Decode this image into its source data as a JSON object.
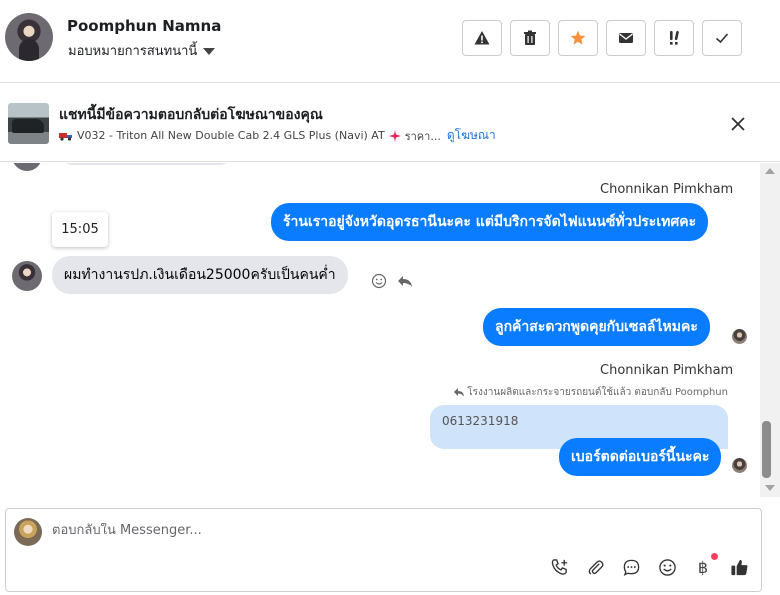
{
  "header": {
    "contact_name": "Poomphun Namna",
    "assign_label": "มอบหมายการสนทนานี้",
    "actions": [
      {
        "name": "spam-button",
        "icon": "warning-icon"
      },
      {
        "name": "delete-button",
        "icon": "trash-icon"
      },
      {
        "name": "star-button",
        "icon": "star-icon",
        "color": "#f7923a"
      },
      {
        "name": "mark-unread-button",
        "icon": "envelope-icon"
      },
      {
        "name": "follow-up-button",
        "icon": "priority-icon"
      },
      {
        "name": "done-button",
        "icon": "check-icon"
      }
    ]
  },
  "ad": {
    "title": "แชทนี้มีข้อความตอบกลับต่อโฆษณาของคุณ",
    "subtitle": "V032 - Triton All New Double Cab 2.4 GLS Plus (Navi) AT",
    "subtitle_tail": "ราคา...",
    "link": "ดูโฆษณา"
  },
  "messages": {
    "sender_1": "Chonnikan Pimkham",
    "out_1": "ร้านเราอยู่จังหวัดอุดรธานีนะคะ แต่มีบริการจัดไฟแนนซ์ทั่วประเทศคะ",
    "timestamp": "15:05",
    "in_1": "ผมทำงานรปภ.เงินเดือน25000ครับเป็นคนค่ำ",
    "out_2": "ลูกค้าสะดวกพูดคุยกับเซลล์ไหมคะ",
    "sender_2": "Chonnikan Pimkham",
    "reply_meta": "โรงงานผลิตและกระจายรถยนต์ใช้แล้ว ตอบกลับ Poomphun",
    "quoted_text": "0613231918",
    "out_3": "เบอร์ตดต่อเบอร์นี้นะคะ"
  },
  "composer": {
    "placeholder": "ตอบกลับใน Messenger...",
    "tools": [
      "add-call-icon",
      "attachment-icon",
      "saved-replies-icon",
      "emoji-icon",
      "payment-icon",
      "like-icon"
    ],
    "payment_symbol": "฿"
  },
  "colors": {
    "outgoing_bubble": "#0a7cff",
    "incoming_bubble": "#e4e6eb",
    "link": "#1b74e4",
    "notification_dot": "#fa3e5f"
  }
}
